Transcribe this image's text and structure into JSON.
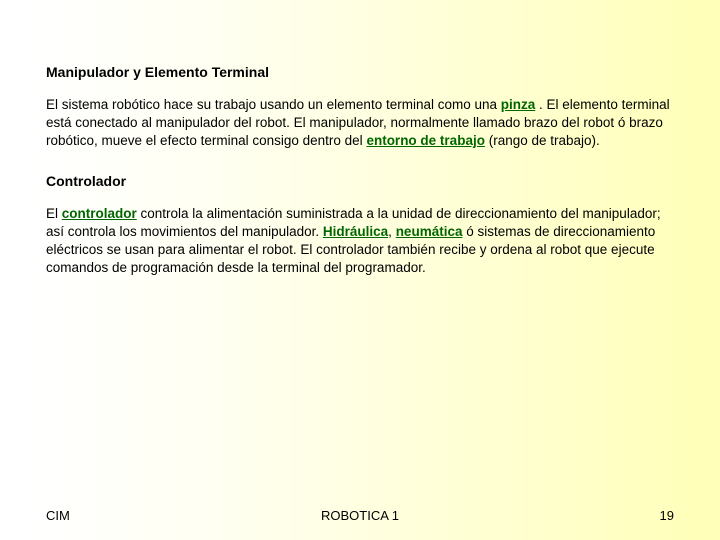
{
  "section1": {
    "heading": "Manipulador y Elemento Terminal",
    "p_a": "El sistema robótico hace su trabajo usando un elemento terminal como una ",
    "link1": "pinza",
    "p_b": " . El elemento terminal está conectado al manipulador del robot. El manipulador, normalmente llamado brazo del robot ó brazo robótico, mueve el efecto terminal consigo dentro del ",
    "link2": "entorno de trabajo",
    "p_c": " (rango de trabajo)."
  },
  "section2": {
    "heading": "Controlador",
    "p_a": "El ",
    "link1": "controlador",
    "p_b": " controla la alimentación suministrada a la unidad de direccionamiento del manipulador; así controla los movimientos del manipulador. ",
    "link2": "Hidráulica",
    "p_c": ", ",
    "link3": "neumática",
    "p_d": " ó sistemas de direccionamiento eléctricos se usan para alimentar el robot. El controlador también recibe y ordena al robot que ejecute comandos de programación desde la terminal del programador."
  },
  "footer": {
    "left": "CIM",
    "center": "ROBOTICA 1",
    "right": "19"
  }
}
